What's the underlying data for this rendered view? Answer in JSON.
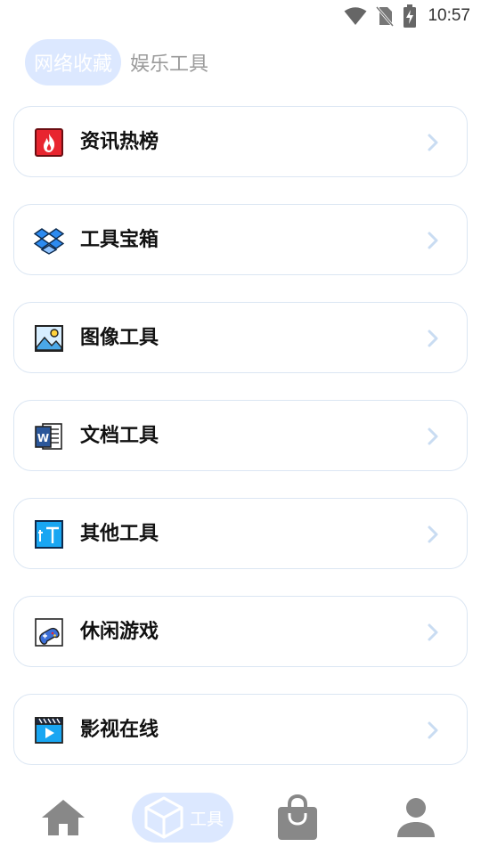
{
  "status_bar": {
    "time": "10:57",
    "icons": [
      "wifi-icon",
      "no-sim-icon",
      "battery-charging-icon"
    ]
  },
  "top_tabs": [
    {
      "label": "网络收藏",
      "active": true
    },
    {
      "label": "娱乐工具",
      "active": false
    }
  ],
  "list": {
    "items": [
      {
        "label": "资讯热榜",
        "icon": "fire-icon"
      },
      {
        "label": "工具宝箱",
        "icon": "dropbox-icon"
      },
      {
        "label": "图像工具",
        "icon": "image-icon"
      },
      {
        "label": "文档工具",
        "icon": "word-document-icon"
      },
      {
        "label": "其他工具",
        "icon": "text-tool-icon"
      },
      {
        "label": "休闲游戏",
        "icon": "gamepad-icon"
      },
      {
        "label": "影视在线",
        "icon": "video-player-icon"
      }
    ]
  },
  "bottom_nav": {
    "items": [
      {
        "icon": "home-icon",
        "label": "",
        "active": false
      },
      {
        "icon": "box-icon",
        "label": "工具",
        "active": true
      },
      {
        "icon": "shopping-bag-icon",
        "label": "",
        "active": false
      },
      {
        "icon": "person-icon",
        "label": "",
        "active": false
      }
    ]
  },
  "colors": {
    "accent_light": "#dce8ff",
    "card_border": "#dbe6f3",
    "nav_icon": "#888888",
    "chevron": "#c9dcf2"
  }
}
